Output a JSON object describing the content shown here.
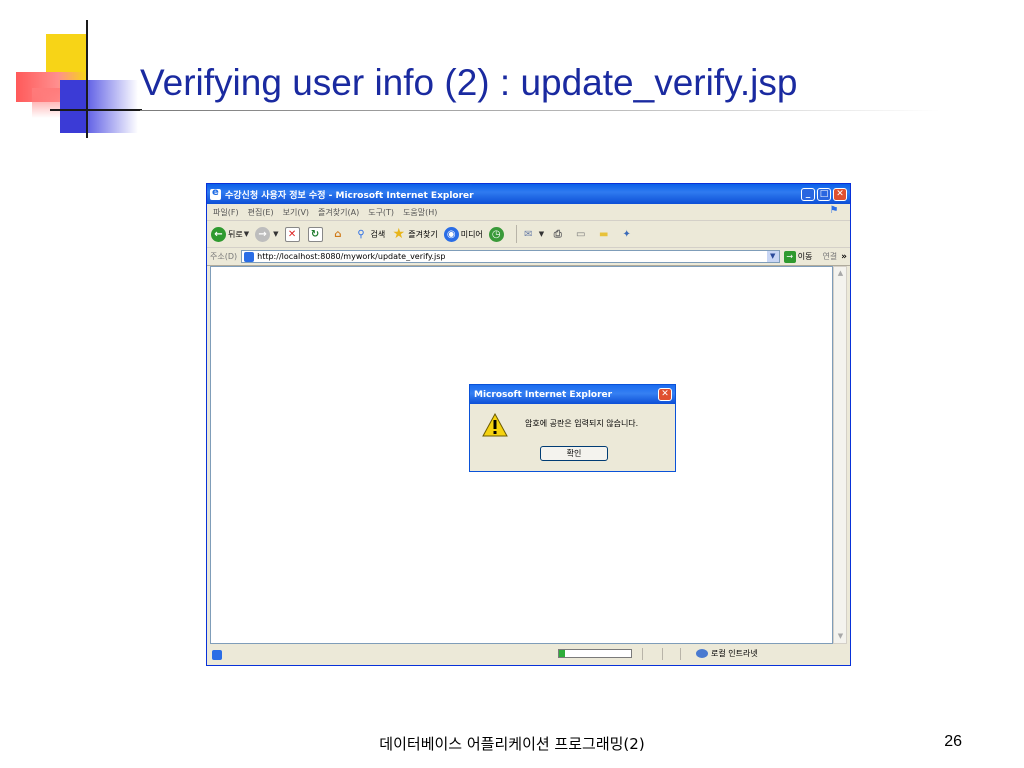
{
  "slide": {
    "title": "Verifying user info (2) : update_verify.jsp",
    "footer": "데이터베이스 어플리케이션 프로그래밍(2)",
    "page_number": "26"
  },
  "window": {
    "title": "수강신청 사용자 정보 수정 - Microsoft Internet Explorer",
    "controls": {
      "minimize": "_",
      "maximize": "□",
      "close": "✕"
    }
  },
  "menubar": {
    "items": [
      "파일(F)",
      "편집(E)",
      "보기(V)",
      "즐겨찾기(A)",
      "도구(T)",
      "도움말(H)"
    ]
  },
  "toolbar": {
    "back_label": "뒤로",
    "search_label": "검색",
    "favorites_label": "즐겨찾기",
    "media_label": "미디어",
    "icons": [
      "back-icon",
      "forward-icon",
      "stop-icon",
      "refresh-icon",
      "home-icon",
      "search-icon",
      "favorites-icon",
      "media-icon",
      "history-icon",
      "mail-icon",
      "print-icon",
      "edit-icon",
      "folder-icon",
      "messenger-icon"
    ]
  },
  "addressbar": {
    "label": "주소(D)",
    "url": "http://localhost:8080/mywork/update_verify.jsp",
    "go_label": "이동",
    "links_label": "연결",
    "more": "»"
  },
  "statusbar": {
    "zone_label": "로컬 인트라넷",
    "progress": 0.08
  },
  "dialog": {
    "title": "Microsoft Internet Explorer",
    "message": "암호에 공란은 입력되지 않습니다.",
    "ok_label": "확인",
    "icon": "warning-icon"
  },
  "colors": {
    "title_text": "#1a2aa0",
    "xp_titlebar": "#0a5fe8",
    "window_face": "#ece9d8"
  }
}
